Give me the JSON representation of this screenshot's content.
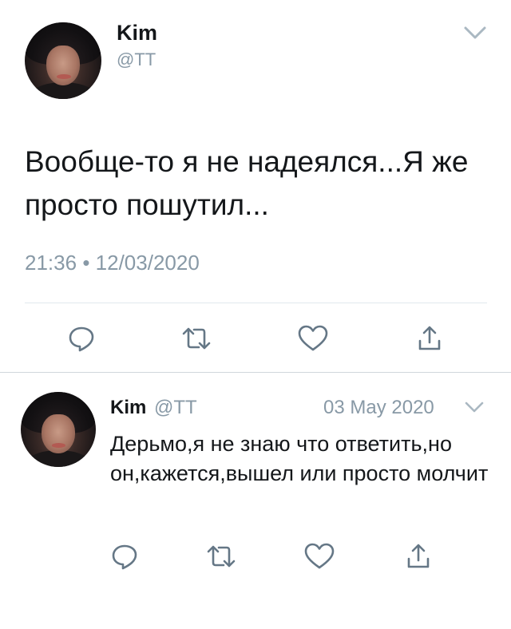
{
  "main_tweet": {
    "name": "Kim",
    "handle": "@TT",
    "text": "Вообще-то я не надеялся...Я же просто пошутил...",
    "time": "21:36",
    "separator": "•",
    "date": "12/03/2020",
    "actions": [
      "reply-icon",
      "retweet-icon",
      "like-icon",
      "share-icon"
    ]
  },
  "reply_tweet": {
    "name": "Kim",
    "handle": "@TT",
    "date": "03 May 2020",
    "text": "Дерьмо,я не знаю что ответить,но он,кажется,вышел или просто молчит",
    "actions": [
      "reply-icon",
      "retweet-icon",
      "like-icon",
      "share-icon"
    ]
  },
  "colors": {
    "text": "#14171a",
    "secondary": "#8899a6",
    "icon": "#657786",
    "divider": "#e1e8ed"
  }
}
